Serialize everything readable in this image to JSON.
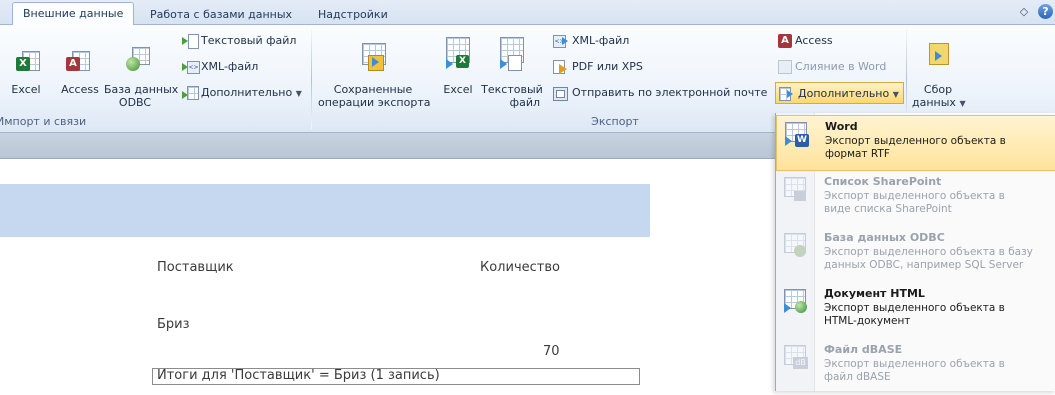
{
  "tabs": [
    {
      "label": "Внешние данные",
      "active": true
    },
    {
      "label": "Работа с базами данных",
      "active": false
    },
    {
      "label": "Надстройки",
      "active": false
    }
  ],
  "window_controls": {
    "help_label": "?",
    "minimize_label": "◇"
  },
  "import_group": {
    "label": "Импорт и связи",
    "excel": "Excel",
    "access": "Access",
    "odbc_line1": "База данных",
    "odbc_line2": "ODBC",
    "text_file": "Текстовый файл",
    "xml_file": "XML-файл",
    "more": "Дополнительно"
  },
  "export_group": {
    "label": "Экспорт",
    "saved_line1": "Сохраненные",
    "saved_line2": "операции экспорта",
    "excel": "Excel",
    "text_line1": "Текстовый",
    "text_line2": "файл",
    "xml_file": "XML-файл",
    "pdf_xps": "PDF или XPS",
    "email": "Отправить по электронной почте",
    "access": "Access",
    "word_merge": "Слияние в Word",
    "more": "Дополнительно"
  },
  "collect_group": {
    "line1": "Сбор",
    "line2": "данных"
  },
  "report": {
    "col_supplier": "Поставщик",
    "col_quantity": "Количество",
    "supplier_value": "Бриз",
    "quantity_value": "70",
    "summary": "Итоги для 'Поставщик' = Бриз (1 запись)"
  },
  "dropdown": {
    "items": [
      {
        "title": "Word",
        "desc": "Экспорт выделенного объекта в формат RTF",
        "enabled": true,
        "highlighted": true,
        "icon": "word-export-icon"
      },
      {
        "title": "Список SharePoint",
        "desc": "Экспорт выделенного объекта в виде списка SharePoint",
        "enabled": false,
        "highlighted": false,
        "icon": "sharepoint-list-icon"
      },
      {
        "title": "База данных ODBC",
        "desc": "Экспорт выделенного объекта в базу данных ODBC, например SQL Server",
        "enabled": false,
        "highlighted": false,
        "icon": "odbc-database-icon"
      },
      {
        "title": "Документ HTML",
        "desc": "Экспорт выделенного объекта в HTML-документ",
        "enabled": true,
        "highlighted": false,
        "icon": "html-document-icon"
      },
      {
        "title": "Файл dBASE",
        "desc": "Экспорт выделенного объекта в файл dBASE",
        "enabled": false,
        "highlighted": false,
        "icon": "dbase-file-icon"
      }
    ]
  },
  "colors": {
    "ribbon_border": "#9fb5d2",
    "highlight": "#ffe39b",
    "report_band": "#c6d8f0"
  }
}
